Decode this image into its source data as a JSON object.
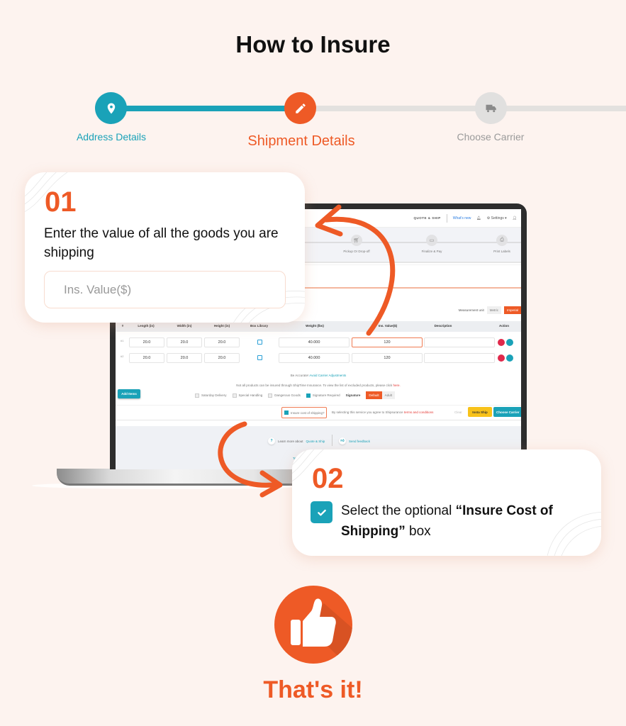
{
  "page": {
    "title": "How to Insure",
    "closing_text": "That's it!"
  },
  "colors": {
    "accent_orange": "#ee5a26",
    "accent_teal": "#1aa2b8",
    "inactive_gray": "#e1e0df",
    "background": "#fdf3ef"
  },
  "stepper": {
    "steps": [
      {
        "label": "Address Details",
        "icon": "map-pin-icon",
        "state": "completed"
      },
      {
        "label": "Shipment Details",
        "icon": "pencil-icon",
        "state": "active"
      },
      {
        "label": "Choose Carrier",
        "icon": "truck-icon",
        "state": "pending"
      }
    ]
  },
  "app": {
    "topbar": {
      "brand": "QUOTE & SHIP",
      "whats_new": "What's new",
      "settings": "Settings"
    },
    "steps": [
      {
        "label": "Pickup Or Drop-off",
        "icon": "cart-icon"
      },
      {
        "label": "Finalize & Pay",
        "icon": "card-icon"
      },
      {
        "label": "Print Labels",
        "icon": "printer-icon"
      }
    ],
    "measurement": {
      "label": "Measurement unit",
      "options": [
        "Metric",
        "Imperial"
      ],
      "selected": "Imperial"
    },
    "table": {
      "headers": [
        "#",
        "Length (in)",
        "Width (in)",
        "Height (in)",
        "Box Library",
        "Weight (lbs)",
        "Ins. Value($)",
        "Description",
        "Action"
      ],
      "rows": [
        {
          "num": "#1",
          "length": "20.0",
          "width": "20.0",
          "height": "20.0",
          "weight": "40.000",
          "ins_value": "120",
          "description": ""
        },
        {
          "num": "#2",
          "length": "20.0",
          "width": "20.0",
          "height": "20.0",
          "weight": "40.000",
          "ins_value": "120",
          "description": ""
        }
      ]
    },
    "notes": {
      "accurate_prefix": "Be Accurate!",
      "accurate_link": "Avoid Carrier Adjustments",
      "insured_text": "Not all products can be insured through ShipTime Insurance. To view the list of excluded products, please click",
      "insured_link": "here."
    },
    "add_items": "Add Items",
    "options": [
      {
        "label": "Saturday Delivery",
        "checked": false
      },
      {
        "label": "Special Handling",
        "checked": false
      },
      {
        "label": "Dangerous Goods",
        "checked": false
      },
      {
        "label": "Signature Required",
        "checked": true
      }
    ],
    "signature": {
      "label": "Signature",
      "options": [
        "Default",
        "Adult"
      ],
      "selected": "Default"
    },
    "insure": {
      "label": "Insure cost of shipping?",
      "checked": true,
      "agree_text": "By selecting this service you agree to Shipsurance",
      "agree_link": "terms and conditions"
    },
    "buttons": {
      "clear": "Clear",
      "insta_ship": "Insta Ship",
      "choose_carrier": "Choose Carrier"
    },
    "footer": {
      "learn_prefix": "Learn more about",
      "learn_link": "Quote & Ship",
      "feedback": "Send feedback",
      "terms": "Terms"
    }
  },
  "cards": [
    {
      "number": "01",
      "text": "Enter the value of all the goods you are shipping",
      "field_placeholder": "Ins. Value($)"
    },
    {
      "number": "02",
      "text_prefix": "Select the optional ",
      "text_bold": "“Insure Cost of Shipping”",
      "text_suffix": " box"
    }
  ]
}
